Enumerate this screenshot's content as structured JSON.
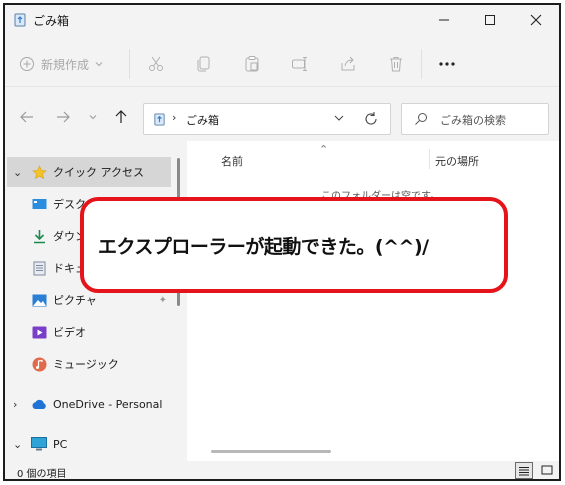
{
  "window": {
    "title": "ごみ箱",
    "controls": {
      "minimize_icon": "minimize-icon",
      "maximize_icon": "maximize-icon",
      "close_icon": "close-icon"
    }
  },
  "toolbar": {
    "new_label": "新規作成",
    "buttons": [
      {
        "name": "cut",
        "icon": "scissors-icon"
      },
      {
        "name": "copy",
        "icon": "copy-icon"
      },
      {
        "name": "paste",
        "icon": "clipboard-icon"
      },
      {
        "name": "rename",
        "icon": "rename-icon"
      },
      {
        "name": "share",
        "icon": "share-icon"
      },
      {
        "name": "delete",
        "icon": "trash-icon"
      }
    ],
    "more_label": "•••"
  },
  "navigation": {
    "address_chevron": "›",
    "address_text": "ごみ箱",
    "search_placeholder": "ごみ箱の検索"
  },
  "sidebar": {
    "items": [
      {
        "chevron": "⌄",
        "label": "クイック アクセス",
        "icon": "star-icon"
      },
      {
        "label": "デスクトップ",
        "icon": "desktop-icon",
        "pinned": true
      },
      {
        "label": "ダウンロード",
        "icon": "download-icon",
        "pinned": true
      },
      {
        "label": "ドキュメント",
        "icon": "document-icon",
        "pinned": true
      },
      {
        "label": "ピクチャ",
        "icon": "picture-icon",
        "pinned": true
      },
      {
        "label": "ビデオ",
        "icon": "video-icon"
      },
      {
        "label": "ミュージック",
        "icon": "music-icon"
      },
      {
        "chevron": "›",
        "label": "OneDrive - Personal",
        "icon": "cloud-icon"
      },
      {
        "chevron": "⌄",
        "label": "PC",
        "icon": "pc-icon"
      }
    ],
    "pin_glyph": "📌"
  },
  "content": {
    "columns": [
      "名前",
      "元の場所"
    ],
    "empty_message": "このフォルダーは空です。"
  },
  "status": {
    "item_count": "0 個の項目"
  },
  "callout": {
    "text": "エクスプローラーが起動できた。(^^)/"
  },
  "colors": {
    "callout_border": "#e5141b",
    "selection": "#d6d6d6",
    "folder_blue": "#2e7dd7"
  }
}
